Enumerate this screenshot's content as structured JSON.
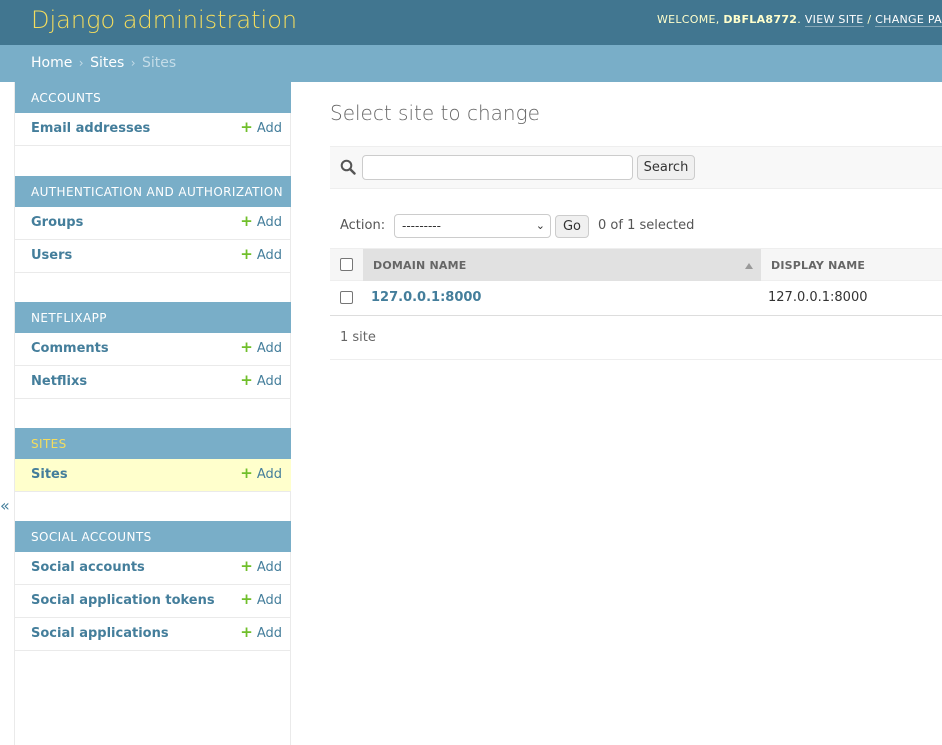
{
  "header": {
    "title": "Django administration",
    "welcome_prefix": "WELCOME, ",
    "username": "DBFLA8772",
    "after_user": ". ",
    "view_site": "VIEW SITE",
    "slash": " / ",
    "change_password": "CHANGE PA"
  },
  "breadcrumbs": {
    "home": "Home",
    "app": "Sites",
    "current": "Sites",
    "separator": "›"
  },
  "sidebar": {
    "add_label": "Add",
    "collapse_glyph": "«",
    "modules": [
      {
        "caption": "ACCOUNTS",
        "models": [
          {
            "name": "Email addresses"
          }
        ]
      },
      {
        "caption": "AUTHENTICATION AND AUTHORIZATION",
        "models": [
          {
            "name": "Groups"
          },
          {
            "name": "Users"
          }
        ]
      },
      {
        "caption": "NETFLIXAPP",
        "models": [
          {
            "name": "Comments"
          },
          {
            "name": "Netflixs"
          }
        ]
      },
      {
        "caption": "SITES",
        "models": [
          {
            "name": "Sites"
          }
        ]
      },
      {
        "caption": "SOCIAL ACCOUNTS",
        "models": [
          {
            "name": "Social accounts"
          },
          {
            "name": "Social application tokens"
          },
          {
            "name": "Social applications"
          }
        ]
      }
    ]
  },
  "content": {
    "title": "Select site to change",
    "search": {
      "value": "",
      "button": "Search"
    },
    "actions": {
      "label": "Action:",
      "selected_option": "---------",
      "go": "Go",
      "counter": "0 of 1 selected"
    },
    "table": {
      "columns": [
        "DOMAIN NAME",
        "DISPLAY NAME"
      ],
      "rows": [
        {
          "domain": "127.0.0.1:8000",
          "display": "127.0.0.1:8000"
        }
      ]
    },
    "paginator": "1 site"
  },
  "colors": {
    "header_bg": "#417690",
    "breadcrumb_bg": "#79aec8",
    "brand_yellow": "#f5dd5d",
    "link_blue": "#447e9b",
    "add_green": "#70bf2b",
    "current_row_bg": "#ffffcc"
  }
}
